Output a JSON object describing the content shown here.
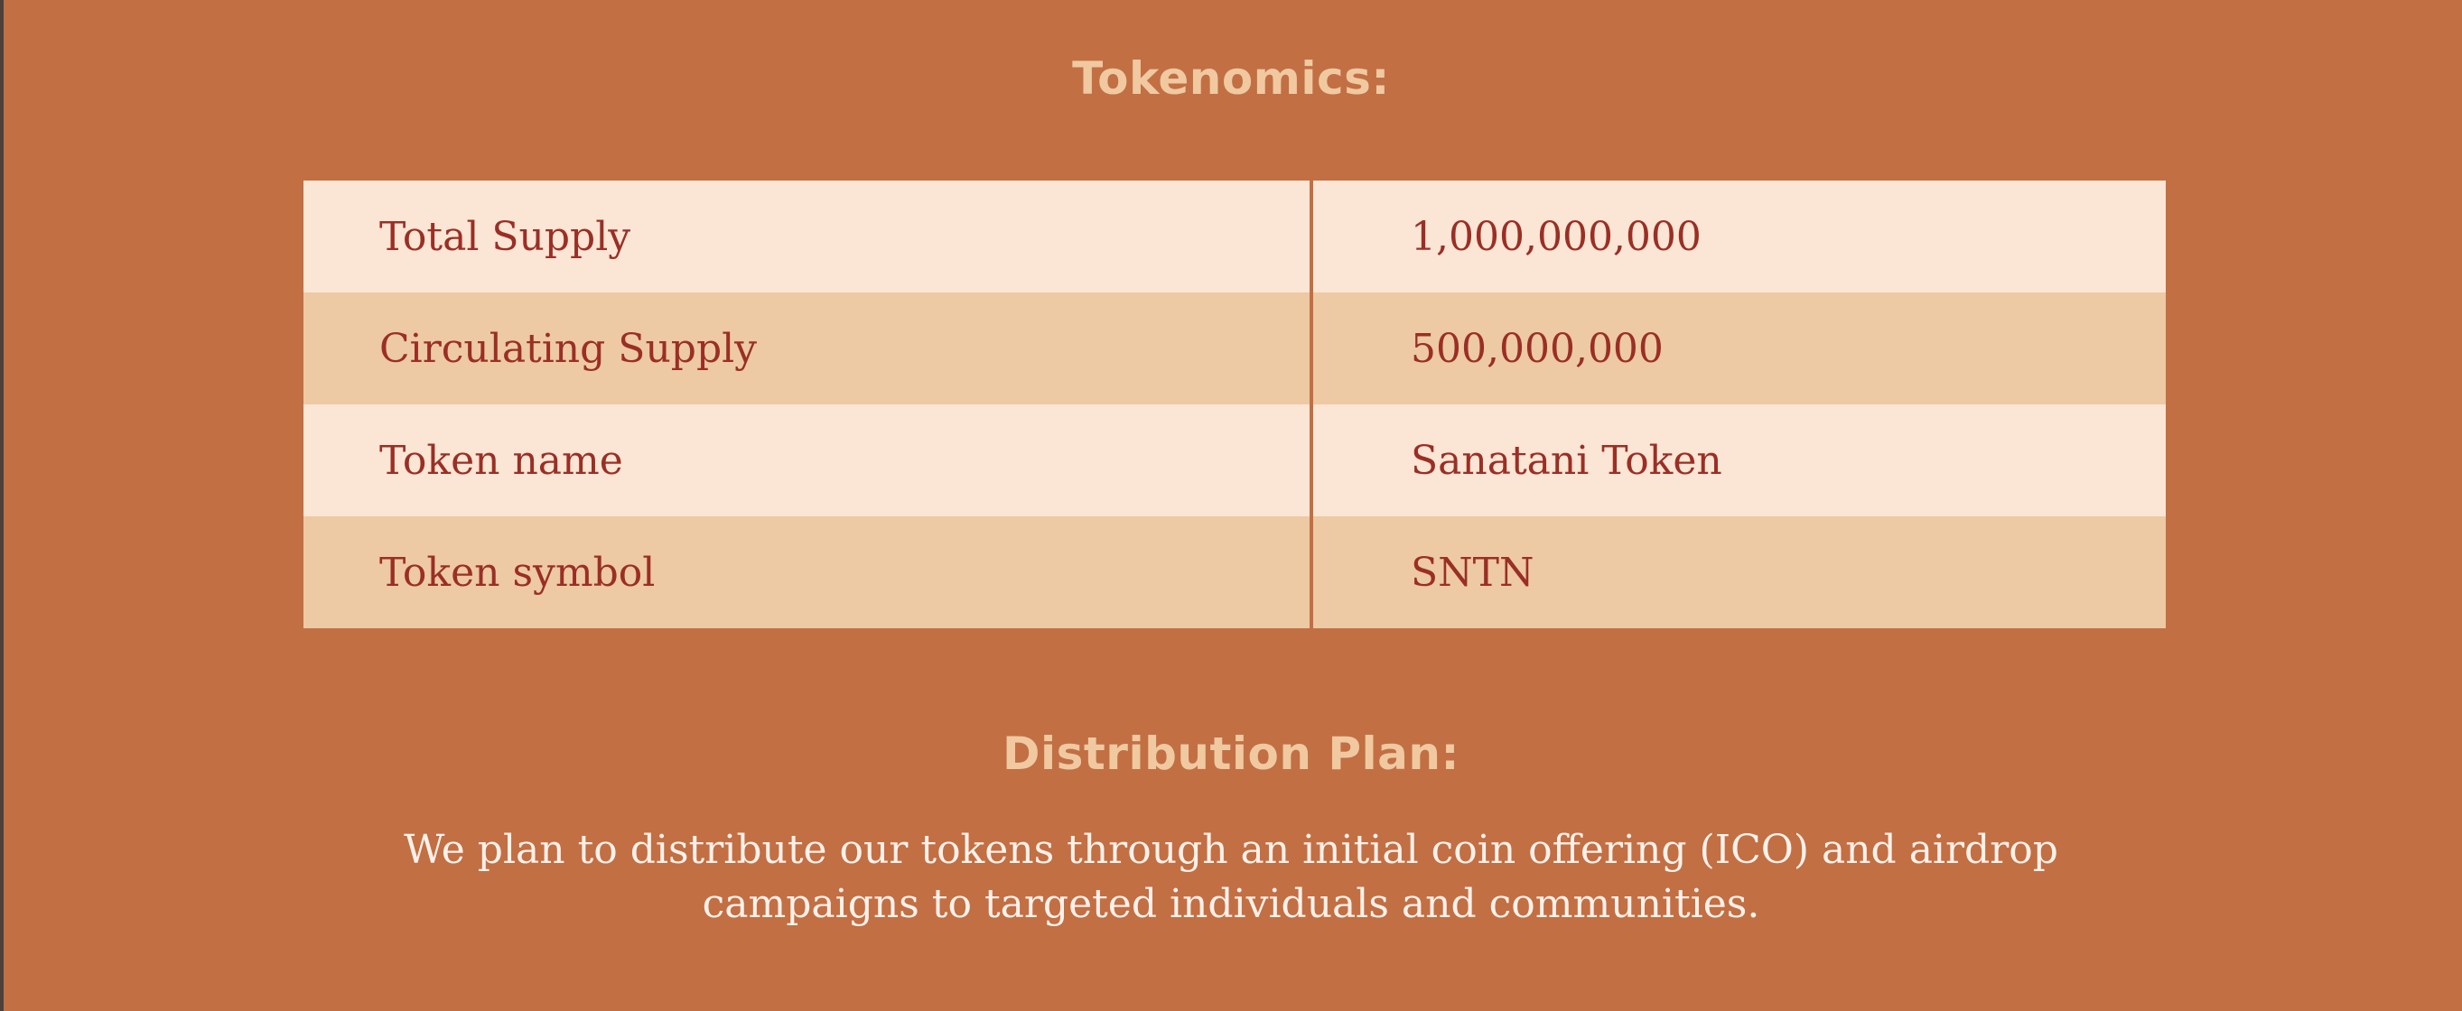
{
  "tokenomics": {
    "title": "Tokenomics:",
    "rows": [
      {
        "label": "Total Supply",
        "value": "1,000,000,000"
      },
      {
        "label": "Circulating Supply",
        "value": "500,000,000"
      },
      {
        "label": "Token name",
        "value": "Sanatani Token"
      },
      {
        "label": "Token symbol",
        "value": "SNTN"
      }
    ]
  },
  "distribution": {
    "title": "Distribution Plan:",
    "text": "We plan to distribute our tokens through an initial coin offering (ICO) and airdrop campaigns to targeted individuals and communities."
  },
  "colors": {
    "background": "#c26f44",
    "heading": "#f0c9a1",
    "table_text": "#9a2f25",
    "row_light": "#fbe5d5",
    "row_dark": "#edc9a4",
    "body_text": "#fdf1ea"
  }
}
